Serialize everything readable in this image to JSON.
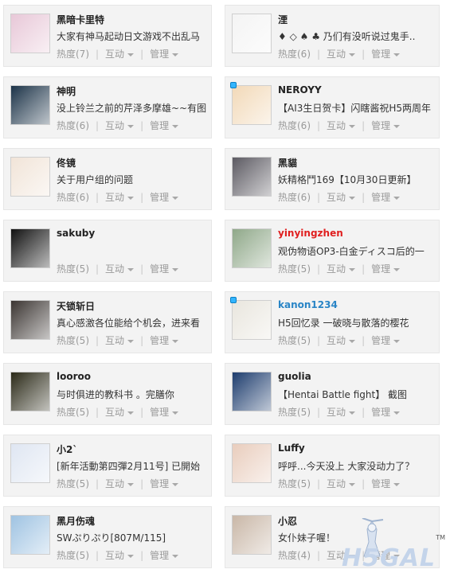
{
  "cards": [
    {
      "name": "黑暗卡里特",
      "msg": "大家有神马起动日文游戏不出乱马",
      "heat": "热度(7)",
      "avatar_color": "#e8c8d8",
      "name_color": "normal",
      "online": false
    },
    {
      "name": "湮",
      "msg": "♦ ◇ ♠ ♣ 乃们有没听说过鬼手..",
      "heat": "热度(6)",
      "avatar_color": "#f4f4f4",
      "name_color": "normal",
      "online": false
    },
    {
      "name": "神明",
      "msg": "没上铃兰之前的芹泽多摩雄~~有图",
      "heat": "热度(6)",
      "avatar_color": "#1c3348",
      "name_color": "normal",
      "online": false
    },
    {
      "name": "NEROYY",
      "msg": "【AI3生日贺卡】闪瞎酱祝H5两周年",
      "heat": "热度(6)",
      "avatar_color": "#f2d9b8",
      "name_color": "normal",
      "online": true
    },
    {
      "name": "佟镜",
      "msg": "关于用户组的问题",
      "heat": "热度(6)",
      "avatar_color": "#f1e4d8",
      "name_color": "normal",
      "online": false
    },
    {
      "name": "黑貓",
      "msg": "妖精格鬥169【10月30日更新】",
      "heat": "热度(6)",
      "avatar_color": "#5c5a62",
      "name_color": "normal",
      "online": false
    },
    {
      "name": "sakuby",
      "msg": "",
      "heat": "热度(5)",
      "avatar_color": "#111111",
      "name_color": "normal",
      "online": false
    },
    {
      "name": "yinyingzhen",
      "msg": "观伪物语OP3-白金ディスコ后的一",
      "heat": "热度(5)",
      "avatar_color": "#8fa889",
      "name_color": "red",
      "online": false
    },
    {
      "name": "天锁斩日",
      "msg": "真心感激各位能给个机会，进来看",
      "heat": "热度(5)",
      "avatar_color": "#3b3532",
      "name_color": "normal",
      "online": false
    },
    {
      "name": "kanon1234",
      "msg": "H5回忆录 一破晓与散落的樱花",
      "heat": "热度(5)",
      "avatar_color": "#e9e6de",
      "name_color": "blue",
      "online": true
    },
    {
      "name": "looroo",
      "msg": "与时俱进的教科书 。完膳你",
      "heat": "热度(5)",
      "avatar_color": "#2b2a18",
      "name_color": "normal",
      "online": false
    },
    {
      "name": "guolia",
      "msg": "【Hentai Battle fight】 截图",
      "heat": "热度(5)",
      "avatar_color": "#1e3d6e",
      "name_color": "normal",
      "online": false
    },
    {
      "name": "小2`",
      "msg": "[新年活動第四彈2月11号]  已開始",
      "heat": "热度(5)",
      "avatar_color": "#dfe6f2",
      "name_color": "normal",
      "online": false
    },
    {
      "name": "Luffy",
      "msg": "呼呼...今天没上 大家没动力了？",
      "heat": "热度(5)",
      "avatar_color": "#e9cdbd",
      "name_color": "normal",
      "online": false
    },
    {
      "name": "黑月伤魂",
      "msg": "SWぷりぷり[807M/115]",
      "heat": "热度(5)",
      "avatar_color": "#9fc3e2",
      "name_color": "normal",
      "online": false
    },
    {
      "name": "小忍",
      "msg": "女仆妹子喔！",
      "heat": "热度(4)",
      "avatar_color": "#c9b7a7",
      "name_color": "normal",
      "online": false
    }
  ],
  "labels": {
    "interact": "互动",
    "manage": "管理"
  },
  "watermark": {
    "text": "H5GAL",
    "tm": "TM"
  }
}
